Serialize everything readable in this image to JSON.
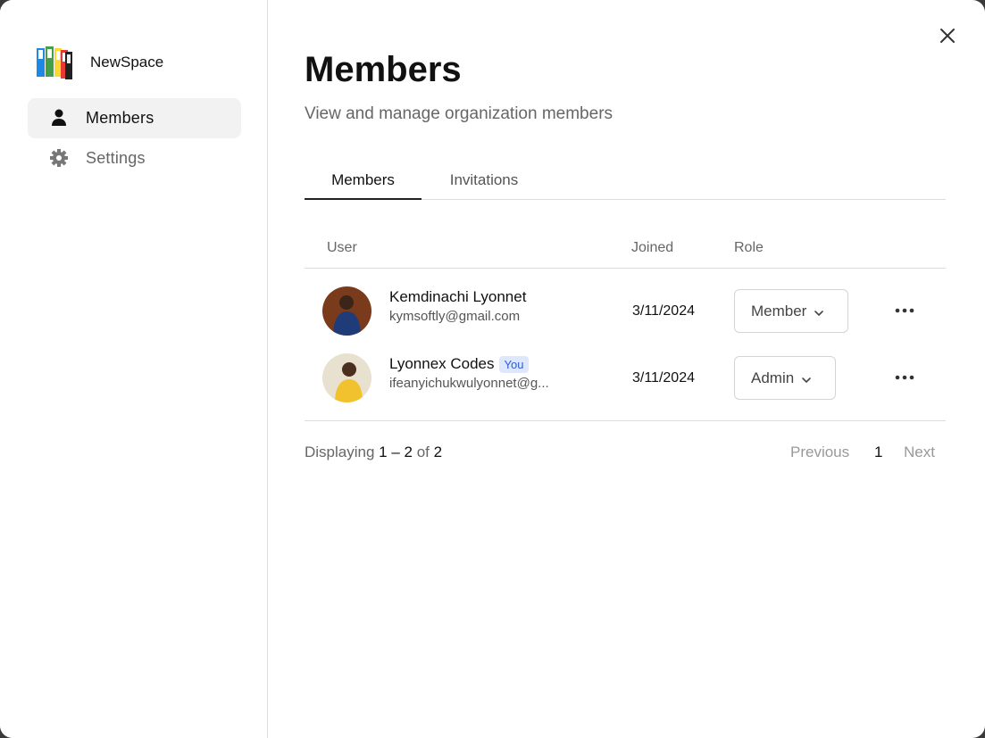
{
  "app": {
    "name": "NewSpace"
  },
  "sidebar": {
    "items": [
      {
        "label": "Members",
        "icon": "person-icon",
        "active": true
      },
      {
        "label": "Settings",
        "icon": "gear-icon",
        "active": false
      }
    ]
  },
  "header": {
    "title": "Members",
    "subtitle": "View and manage organization members"
  },
  "tabs": [
    {
      "label": "Members",
      "active": true
    },
    {
      "label": "Invitations",
      "active": false
    }
  ],
  "table": {
    "columns": [
      "User",
      "Joined",
      "Role"
    ],
    "rows": [
      {
        "name": "Kemdinachi Lyonnet",
        "email": "kymsoftly@gmail.com",
        "joined": "3/11/2024",
        "role": "Member",
        "badge": ""
      },
      {
        "name": "Lyonnex Codes",
        "email": "ifeanyichukwulyonnet@g...",
        "joined": "3/11/2024",
        "role": "Admin",
        "badge": "You"
      }
    ]
  },
  "footer": {
    "displaying_prefix": "Displaying",
    "range": "1 – 2",
    "of_word": "of",
    "total": "2",
    "previous": "Previous",
    "current_page": "1",
    "next": "Next"
  },
  "colors": {
    "badge_bg": "#dde8ff",
    "badge_text": "#2d5bd6",
    "active_nav_bg": "#f2f2f2"
  }
}
